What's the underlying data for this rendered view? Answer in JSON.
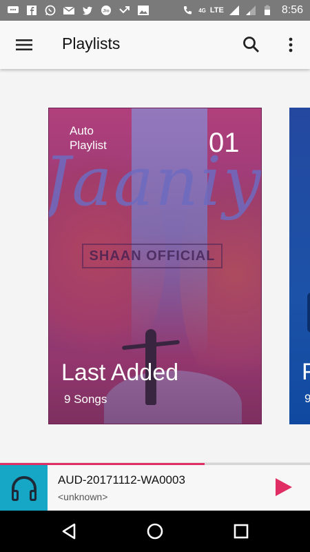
{
  "status_bar": {
    "network_small": "4G",
    "network_type": "LTE",
    "time": "8:56",
    "icons": [
      "messages-icon",
      "facebook-icon",
      "whatsapp-icon",
      "gmail-icon",
      "twitter-icon",
      "jio-icon",
      "missed-call-icon",
      "gallery-icon",
      "call-icon",
      "signal-icon",
      "signal-icon-2",
      "battery-icon"
    ],
    "jio_label": "Jio"
  },
  "app_bar": {
    "title": "Playlists",
    "icons": [
      "menu-icon",
      "search-icon",
      "more-vert-icon"
    ]
  },
  "playlists": [
    {
      "badge": "Auto Playlist",
      "number": "01",
      "title": "Last Added",
      "subtitle": "9 Songs",
      "art_wordmark": "Jaaniye",
      "art_brand": "SHAAN OFFICIAL",
      "color": "#a03c78"
    },
    {
      "title": "F",
      "subtitle": "9",
      "color": "#1c4aa2"
    }
  ],
  "mini_player": {
    "title": "AUD-20171112-WA0003",
    "artist": "<unknown>",
    "progress": 0.66,
    "accent": "#e02d64",
    "art_color": "#16a7c6",
    "icons": [
      "headphones-icon",
      "play-icon"
    ]
  },
  "nav_bar": {
    "icons": [
      "back-icon",
      "home-icon",
      "recents-icon"
    ]
  }
}
